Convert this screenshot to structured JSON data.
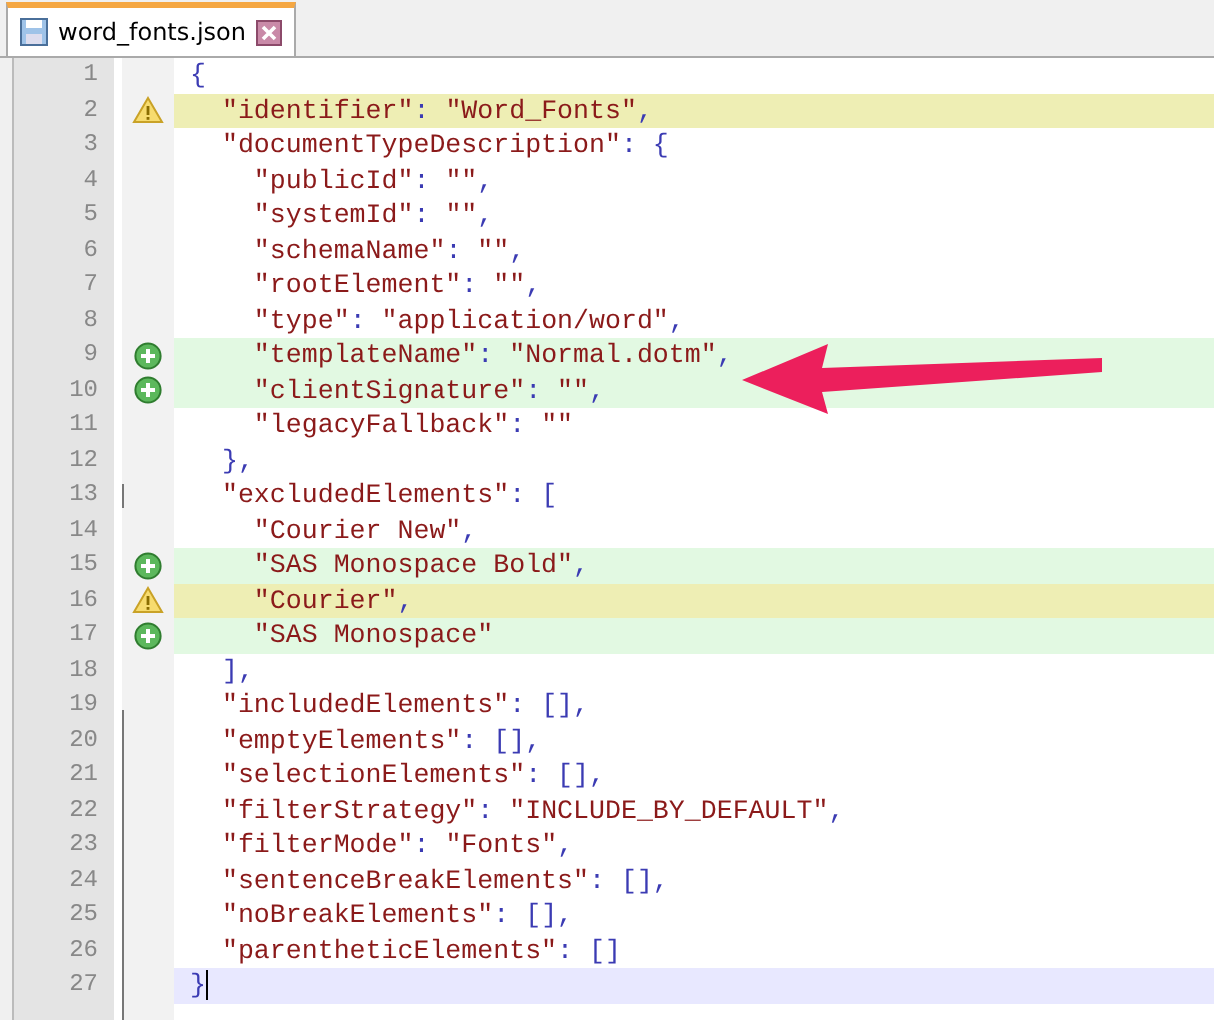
{
  "tab": {
    "label": "word_fonts.json",
    "selected": true
  },
  "lines": [
    {
      "number": "1",
      "kind": "plain",
      "code": "{"
    },
    {
      "number": "2",
      "kind": "warning",
      "code": "  \"identifier\": \"Word_Fonts\","
    },
    {
      "number": "3",
      "kind": "plain",
      "code": "  \"documentTypeDescription\": {"
    },
    {
      "number": "4",
      "kind": "plain",
      "code": "    \"publicId\": \"\","
    },
    {
      "number": "5",
      "kind": "plain",
      "code": "    \"systemId\": \"\","
    },
    {
      "number": "6",
      "kind": "plain",
      "code": "    \"schemaName\": \"\","
    },
    {
      "number": "7",
      "kind": "plain",
      "code": "    \"rootElement\": \"\","
    },
    {
      "number": "8",
      "kind": "plain",
      "code": "    \"type\": \"application/word\","
    },
    {
      "number": "9",
      "kind": "added",
      "code": "    \"templateName\": \"Normal.dotm\","
    },
    {
      "number": "10",
      "kind": "added",
      "code": "    \"clientSignature\": \"\","
    },
    {
      "number": "11",
      "kind": "plain",
      "code": "    \"legacyFallback\": \"\""
    },
    {
      "number": "12",
      "kind": "plain",
      "code": "  },"
    },
    {
      "number": "13",
      "kind": "plain",
      "code": "  \"excludedElements\": ["
    },
    {
      "number": "14",
      "kind": "plain",
      "code": "    \"Courier New\","
    },
    {
      "number": "15",
      "kind": "added",
      "code": "    \"SAS Monospace Bold\","
    },
    {
      "number": "16",
      "kind": "warning",
      "code": "    \"Courier\","
    },
    {
      "number": "17",
      "kind": "added",
      "code": "    \"SAS Monospace\""
    },
    {
      "number": "18",
      "kind": "plain",
      "code": "  ],"
    },
    {
      "number": "19",
      "kind": "plain",
      "code": "  \"includedElements\": [],"
    },
    {
      "number": "20",
      "kind": "plain",
      "code": "  \"emptyElements\": [],"
    },
    {
      "number": "21",
      "kind": "plain",
      "code": "  \"selectionElements\": [],"
    },
    {
      "number": "22",
      "kind": "plain",
      "code": "  \"filterStrategy\": \"INCLUDE_BY_DEFAULT\","
    },
    {
      "number": "23",
      "kind": "plain",
      "code": "  \"filterMode\": \"Fonts\","
    },
    {
      "number": "24",
      "kind": "plain",
      "code": "  \"sentenceBreakElements\": [],"
    },
    {
      "number": "25",
      "kind": "plain",
      "code": "  \"noBreakElements\": [],"
    },
    {
      "number": "26",
      "kind": "plain",
      "code": "  \"parentheticElements\": []"
    },
    {
      "number": "27",
      "kind": "current",
      "code": "}"
    }
  ]
}
